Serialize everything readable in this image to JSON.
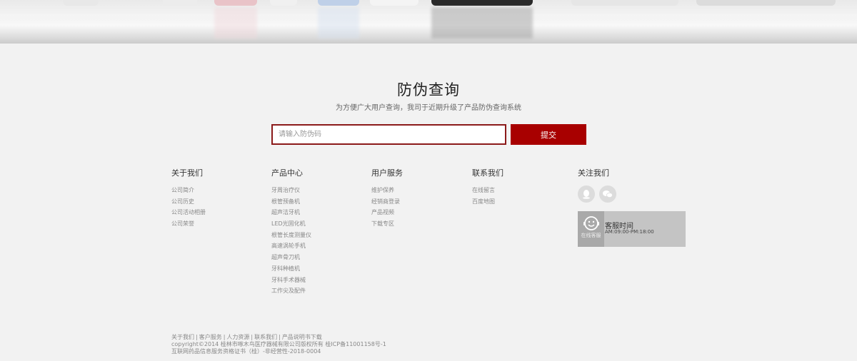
{
  "search": {
    "title": "防伪查询",
    "subtitle": "为方便广大用户查询，我司于近期升级了产品防伪查询系统",
    "placeholder": "请输入防伪码",
    "submit_label": "提交"
  },
  "footer": {
    "columns": [
      {
        "title": "关于我们",
        "items": [
          "公司简介",
          "公司历史",
          "公司活动相册",
          "公司荣誉"
        ]
      },
      {
        "title": "产品中心",
        "items": [
          "牙周治疗仪",
          "根管预备机",
          "超声洁牙机",
          "LED光固化机",
          "根管长度测量仪",
          "高速涡轮手机",
          "超声骨刀机",
          "牙科种植机",
          "牙科手术器械",
          "工作尖及配件"
        ]
      },
      {
        "title": "用户服务",
        "items": [
          "维护保养",
          "经销商登录",
          "产品视频",
          "下载专区"
        ]
      },
      {
        "title": "联系我们",
        "items": [
          "在线留言",
          "百度地图"
        ]
      }
    ],
    "follow": {
      "title": "关注我们",
      "icons": [
        "qq-icon",
        "wechat-icon"
      ]
    },
    "service": {
      "avatar_label": "在线客服",
      "title": "客服时间",
      "hours": "AM:09:00-PM:18:00"
    },
    "bottom_links": [
      "关于我们",
      "客户服务",
      "人力资源",
      "联系我们",
      "产品说明书下载"
    ],
    "copyright": "copyright©2014 桂林市啄木鸟医疗器械有限公司版权所有 桂ICP备11001158号-1",
    "license": "互联网药品信息服务资格证书（桂）-非经营性-2018-0004"
  },
  "colors": {
    "accent": "#a80000",
    "input_border": "#8b1a1a",
    "background": "#f2f2f2"
  }
}
